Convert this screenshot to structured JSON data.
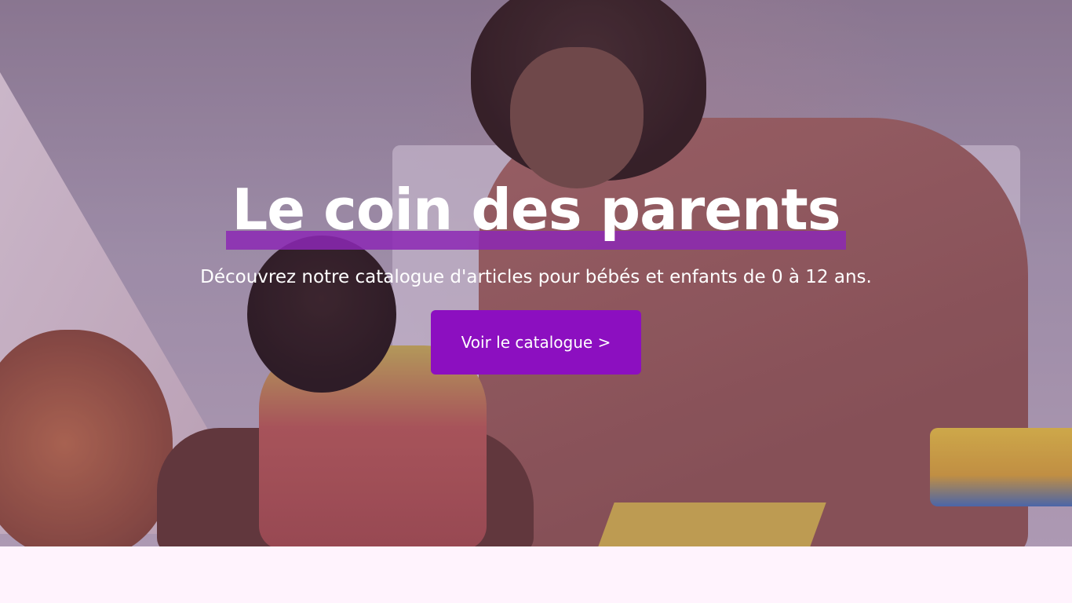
{
  "hero": {
    "title": "Le coin des parents",
    "subtitle": "Découvrez notre catalogue d'articles pour bébés et enfants de 0 à 12 ans.",
    "cta_label": "Voir le catalogue >"
  },
  "colors": {
    "accent": "#8c0fc0",
    "underline": "#8c28b4",
    "page_background": "#fff3fd",
    "text": "#ffffff"
  }
}
